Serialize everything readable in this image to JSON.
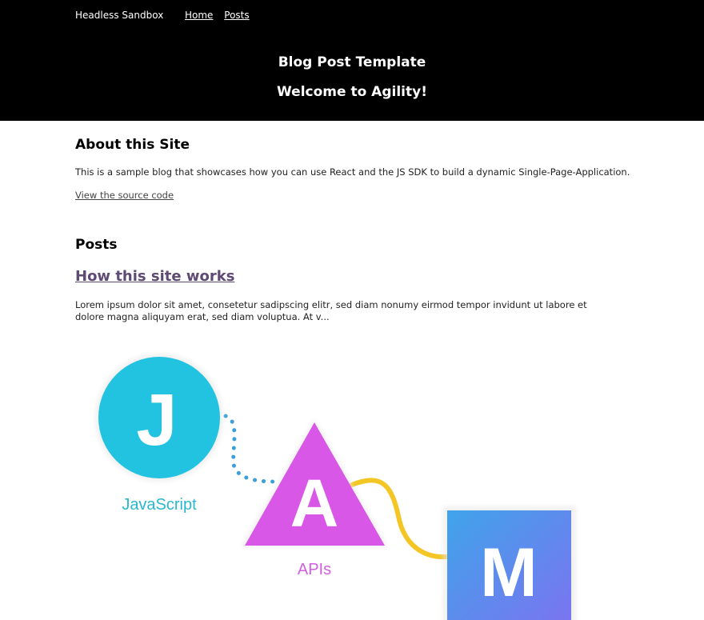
{
  "header": {
    "brand": "Headless Sandbox",
    "nav": [
      {
        "label": "Home"
      },
      {
        "label": "Posts"
      }
    ],
    "title": "Blog Post Template",
    "welcome": "Welcome to Agility!"
  },
  "about": {
    "title": "About this Site",
    "text": "This is a sample blog that showcases how you can use React and the JS SDK to build a dynamic Single-Page-Application.",
    "link": "View the source code"
  },
  "posts": {
    "title": "Posts",
    "items": [
      {
        "title": "How this site works",
        "excerpt": "Lorem ipsum dolor sit amet, consetetur sadipscing elitr, sed diam nonumy eirmod tempor invidunt ut labore et dolore magna aliquyam erat, sed diam voluptua. At v..."
      }
    ]
  },
  "illustration": {
    "js_letter": "J",
    "js_label": "JavaScript",
    "api_letter": "A",
    "api_label": "APIs",
    "markup_letter": "M",
    "colors": {
      "js": "#22c3e0",
      "api": "#d957e6",
      "markup_start": "#3fa4ea",
      "markup_end": "#7d72f0",
      "dots": "#3a9fd8",
      "curve": "#f3c625"
    }
  }
}
